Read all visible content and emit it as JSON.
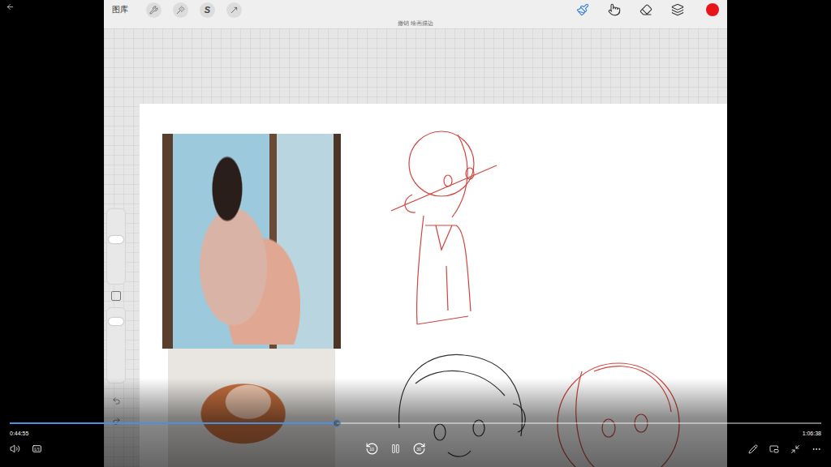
{
  "app": {
    "gallery": "图库",
    "selection_glyph": "S",
    "toast": "撤销 绘画描边",
    "color": "#e8131b"
  },
  "tools": [
    {
      "selected": true
    },
    {
      "selected": false
    },
    {
      "selected": false
    },
    {
      "selected": false
    }
  ],
  "sliders": [
    {
      "level": 0.6
    },
    {
      "level": 0.85
    }
  ],
  "player": {
    "elapsed": "0:44:55",
    "duration": "1:06:38",
    "level": 0.403,
    "skip_back": "10",
    "skip_forward": "30",
    "playing": true
  }
}
